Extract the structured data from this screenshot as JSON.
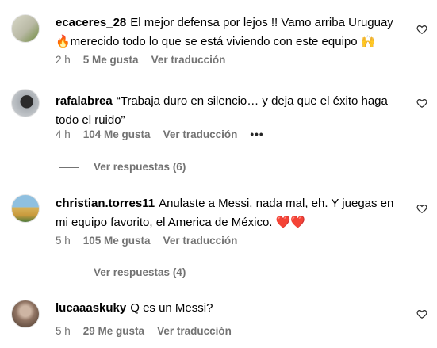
{
  "comments": [
    {
      "username": "ecaceres_28",
      "text": "El mejor defensa por lejos !! Vamo arriba Uruguay 🔥merecido todo lo que se está viviendo con este equipo 🙌",
      "time": "2 h",
      "likes": "5 Me gusta",
      "translate": "Ver traducción",
      "avatar_colors": [
        "#c9c9b8",
        "#6e8a3c"
      ]
    },
    {
      "username": "rafalabrea",
      "text": "“Trabaja duro en silencio… y deja que el éxito haga todo el ruido”",
      "time": "4 h",
      "likes": "104 Me gusta",
      "translate": "Ver traducción",
      "more": "•••",
      "replies": "Ver respuestas (6)",
      "avatar_colors": [
        "#c8ccd0",
        "#2b2b2b"
      ]
    },
    {
      "username": "christian.torres11",
      "text": "Anulaste a Messi, nada mal, eh. Y juegas en mi equipo favorito, el America de México. ❤️❤️",
      "time": "5 h",
      "likes": "105 Me gusta",
      "translate": "Ver traducción",
      "replies": "Ver respuestas (4)",
      "avatar_colors": [
        "#7fb3d5",
        "#d8b35a"
      ]
    },
    {
      "username": "lucaaaskuky",
      "text": "Q es un Messi?",
      "time": "5 h",
      "likes": "29 Me gusta",
      "translate": "Ver traducción",
      "avatar_colors": [
        "#b89f8c",
        "#5a4535"
      ]
    }
  ],
  "icons": {
    "like": "heart-outline-icon"
  },
  "colors": {
    "muted": "#737373",
    "text": "#000000"
  }
}
